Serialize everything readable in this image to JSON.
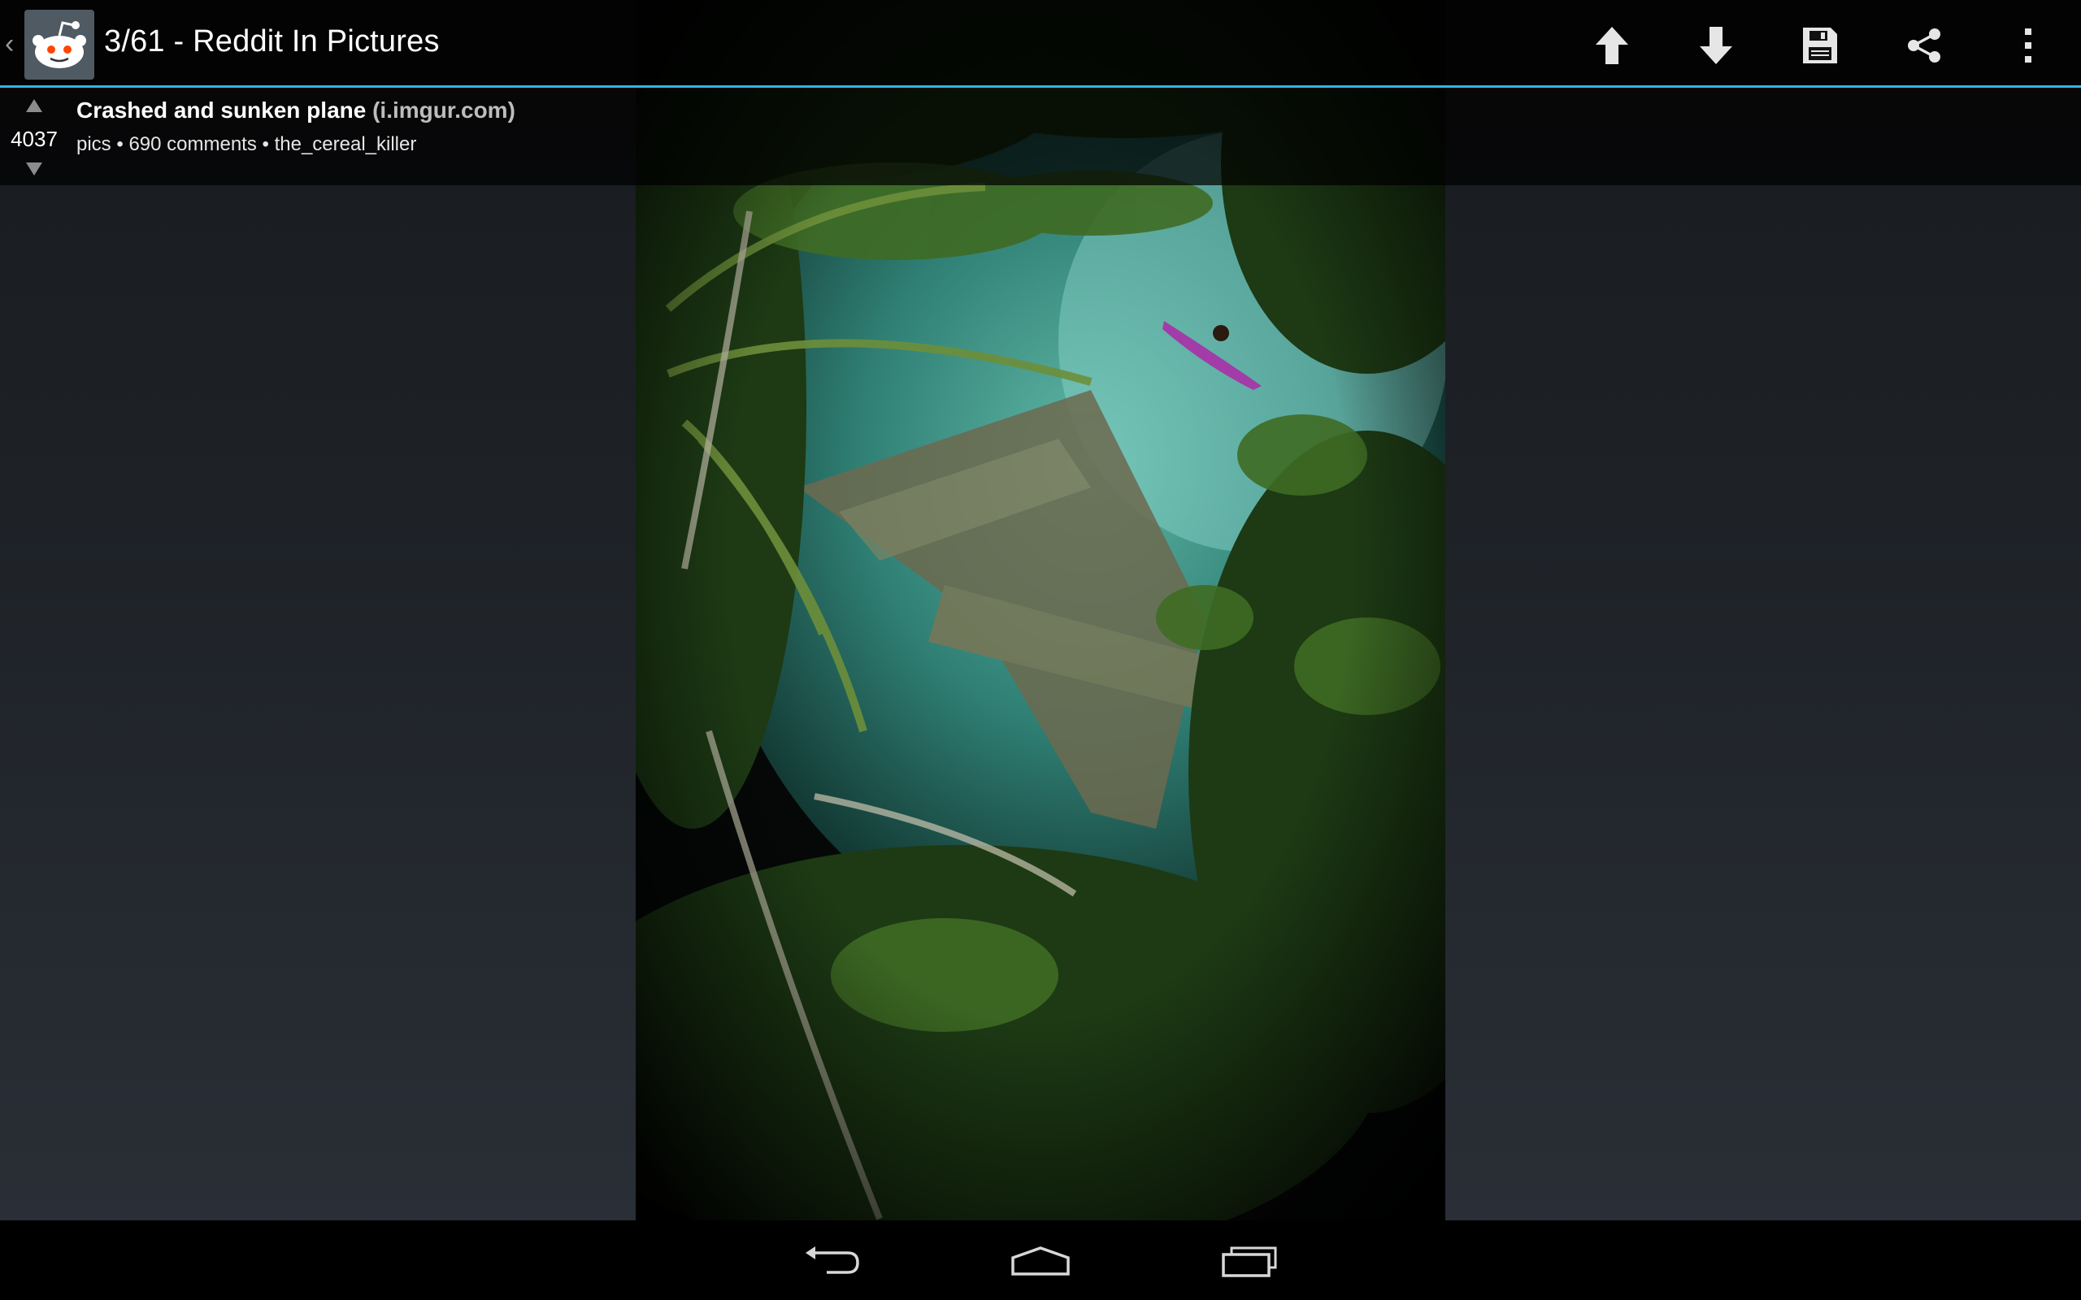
{
  "actionbar": {
    "title": "3/61 - Reddit In Pictures",
    "buttons": [
      {
        "name": "upvote",
        "icon": "arrow-up-icon"
      },
      {
        "name": "downvote",
        "icon": "arrow-down-icon"
      },
      {
        "name": "save",
        "icon": "floppy-disk-icon"
      },
      {
        "name": "share",
        "icon": "share-icon"
      },
      {
        "name": "overflow",
        "icon": "more-vert-icon"
      }
    ],
    "accent_color": "#33b5e5"
  },
  "post": {
    "score": "4037",
    "title": "Crashed and sunken plane",
    "domain": "(i.imgur.com)",
    "subreddit": "pics",
    "comments": "690 comments",
    "author": "the_cereal_killer",
    "separator": "•"
  },
  "navbar": {
    "buttons": [
      {
        "name": "back",
        "icon": "back-icon"
      },
      {
        "name": "home",
        "icon": "home-icon"
      },
      {
        "name": "recents",
        "icon": "recent-apps-icon"
      }
    ]
  }
}
